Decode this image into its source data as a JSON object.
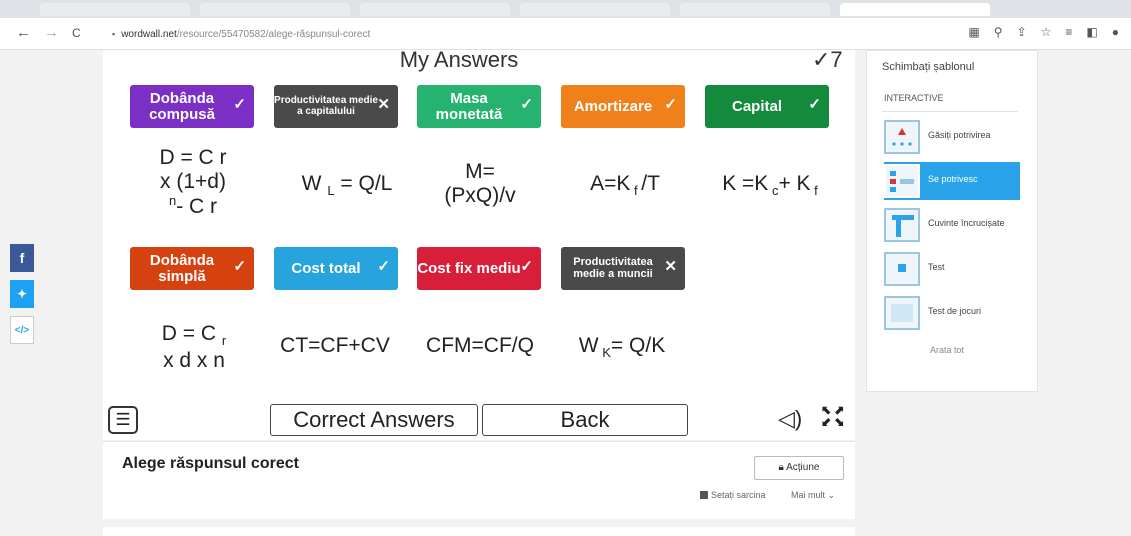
{
  "browser": {
    "url_host": "wordwall.net",
    "url_path": "/resource/55470582/alege-răspunsul-corect"
  },
  "game": {
    "title": "My Answers",
    "score": "✓7",
    "tiles": [
      {
        "label": "Dobânda compusă",
        "mark": "✓",
        "color": "#7b2fc4"
      },
      {
        "label": "Productivitatea medie a capitalului",
        "mark": "✕",
        "color": "#4a4a4a"
      },
      {
        "label": "Masa monetată",
        "mark": "✓",
        "color": "#26b36f"
      },
      {
        "label": "Amortizare",
        "mark": "✓",
        "color": "#f0811a"
      },
      {
        "label": "Capital",
        "mark": "✓",
        "color": "#138a3c"
      },
      {
        "label": "Dobânda simplă",
        "mark": "✓",
        "color": "#d6420f"
      },
      {
        "label": "Cost total",
        "mark": "✓",
        "color": "#27a3de"
      },
      {
        "label": "Cost fix mediu",
        "mark": "✓",
        "color": "#d71f3a"
      },
      {
        "label": "Productivitatea medie a muncii",
        "mark": "✕",
        "color": "#4a4a4a"
      }
    ],
    "formulas": {
      "f1_l1": "D = C r",
      "f1_l2": "x (1+d)",
      "f1_l3a": "n",
      "f1_l3b": "- C r",
      "f2_a": "W",
      "f2_sub": "L",
      "f2_b": "= Q/L",
      "f3_l1": "M=",
      "f3_l2": "(PxQ)/v",
      "f4_a": "A=K",
      "f4_sub": "f",
      "f4_b": "/T",
      "f5_a": "K =K",
      "f5_sub1": "c",
      "f5_b": "+ K",
      "f5_sub2": "f",
      "f6_a": "D = C",
      "f6_sub": "r",
      "f6_l2": "x d x n",
      "f7": "CT=CF+CV",
      "f8": "CFM=CF/Q",
      "f9_a": "W",
      "f9_sub": "K",
      "f9_b": "= Q/K"
    },
    "correct_answers_label": "Correct Answers",
    "back_label": "Back"
  },
  "card": {
    "title": "Alege răspunsul corect",
    "action_label": "Acțiune",
    "task_label": "Setați sarcina",
    "more_label": "Mai mult ⌄"
  },
  "sidebar": {
    "heading": "Schimbați șablonul",
    "subheading": "INTERACTIVE",
    "items": [
      {
        "label": "Găsiți potrivirea"
      },
      {
        "label": "Se potrivesc"
      },
      {
        "label": "Cuvinte încrucișate"
      },
      {
        "label": "Test"
      },
      {
        "label": "Test de jocuri"
      }
    ],
    "show_all": "Arata tot"
  },
  "share": {
    "facebook": "f",
    "twitter": "🐦",
    "embed": "</>"
  },
  "icons": {
    "back": "←",
    "forward": "→",
    "reload": "C",
    "lock": "🔒",
    "menu": "☰",
    "sound": "🔈"
  }
}
